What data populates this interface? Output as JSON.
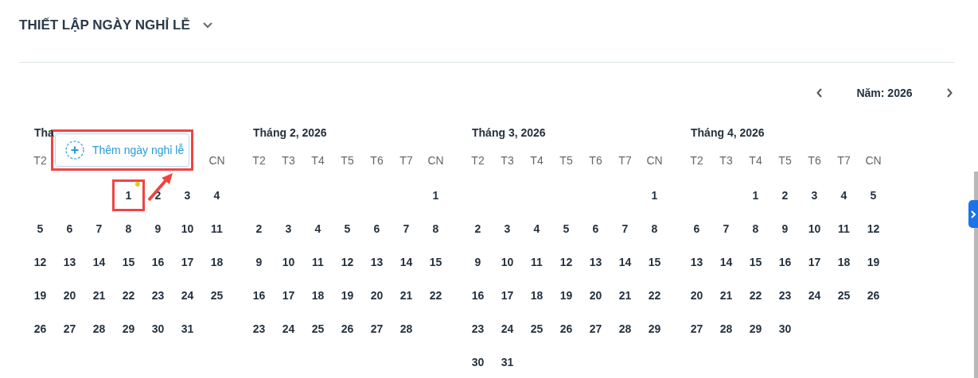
{
  "section": {
    "title": "THIẾT LẬP NGÀY NGHỈ LỄ",
    "expanded": true
  },
  "year_nav": {
    "label": "Năm: 2026"
  },
  "months": [
    {
      "title": "Tha",
      "weekdays": [
        {
          "label": "T2",
          "kind": "regular"
        },
        {
          "label": "CN",
          "kind": "last"
        }
      ],
      "weeks": [
        {
          "kind": "leading",
          "days": [
            {
              "d": "1",
              "dot": true,
              "highlighted": true
            },
            {
              "d": "2",
              "dot": false,
              "highlighted": false
            },
            {
              "d": "3",
              "dot": false,
              "highlighted": false
            },
            {
              "d": "4",
              "dot": false,
              "highlighted": false
            }
          ]
        },
        {
          "kind": "regular",
          "days": [
            {
              "d": "5",
              "dot": false,
              "highlighted": false
            },
            {
              "d": "6",
              "dot": false,
              "highlighted": false
            },
            {
              "d": "7",
              "dot": false,
              "highlighted": false
            },
            {
              "d": "8",
              "dot": false,
              "highlighted": false
            },
            {
              "d": "9",
              "dot": false,
              "highlighted": false
            },
            {
              "d": "10",
              "dot": false,
              "highlighted": false
            },
            {
              "d": "11",
              "dot": false,
              "highlighted": false
            }
          ]
        },
        {
          "kind": "regular",
          "days": [
            {
              "d": "12",
              "dot": false,
              "highlighted": false
            },
            {
              "d": "13",
              "dot": false,
              "highlighted": false
            },
            {
              "d": "14",
              "dot": false,
              "highlighted": false
            },
            {
              "d": "15",
              "dot": false,
              "highlighted": false
            },
            {
              "d": "16",
              "dot": false,
              "highlighted": false
            },
            {
              "d": "17",
              "dot": false,
              "highlighted": false
            },
            {
              "d": "18",
              "dot": false,
              "highlighted": false
            }
          ]
        },
        {
          "kind": "regular",
          "days": [
            {
              "d": "19",
              "dot": false,
              "highlighted": false
            },
            {
              "d": "20",
              "dot": false,
              "highlighted": false
            },
            {
              "d": "21",
              "dot": false,
              "highlighted": false
            },
            {
              "d": "22",
              "dot": false,
              "highlighted": false
            },
            {
              "d": "23",
              "dot": false,
              "highlighted": false
            },
            {
              "d": "24",
              "dot": false,
              "highlighted": false
            },
            {
              "d": "25",
              "dot": false,
              "highlighted": false
            }
          ]
        },
        {
          "kind": "regular",
          "days": [
            {
              "d": "26",
              "dot": false,
              "highlighted": false
            },
            {
              "d": "27",
              "dot": false,
              "highlighted": false
            },
            {
              "d": "28",
              "dot": false,
              "highlighted": false
            },
            {
              "d": "29",
              "dot": false,
              "highlighted": false
            },
            {
              "d": "30",
              "dot": false,
              "highlighted": false
            },
            {
              "d": "31",
              "dot": false,
              "highlighted": false
            }
          ]
        }
      ]
    },
    {
      "title": "Tháng 2, 2026",
      "weekdays": [
        "T2",
        "T3",
        "T4",
        "T5",
        "T6",
        "T7",
        "CN"
      ],
      "weeks": [
        {
          "kind": "leading",
          "days": [
            {
              "d": "1",
              "dot": false,
              "highlighted": false
            }
          ]
        },
        {
          "kind": "regular",
          "days": [
            {
              "d": "2",
              "dot": false,
              "highlighted": false
            },
            {
              "d": "3",
              "dot": false,
              "highlighted": false
            },
            {
              "d": "4",
              "dot": false,
              "highlighted": false
            },
            {
              "d": "5",
              "dot": false,
              "highlighted": false
            },
            {
              "d": "6",
              "dot": false,
              "highlighted": false
            },
            {
              "d": "7",
              "dot": false,
              "highlighted": false
            },
            {
              "d": "8",
              "dot": false,
              "highlighted": false
            }
          ]
        },
        {
          "kind": "regular",
          "days": [
            {
              "d": "9",
              "dot": false,
              "highlighted": false
            },
            {
              "d": "10",
              "dot": false,
              "highlighted": false
            },
            {
              "d": "11",
              "dot": false,
              "highlighted": false
            },
            {
              "d": "12",
              "dot": false,
              "highlighted": false
            },
            {
              "d": "13",
              "dot": false,
              "highlighted": false
            },
            {
              "d": "14",
              "dot": false,
              "highlighted": false
            },
            {
              "d": "15",
              "dot": false,
              "highlighted": false
            }
          ]
        },
        {
          "kind": "regular",
          "days": [
            {
              "d": "16",
              "dot": false,
              "highlighted": false
            },
            {
              "d": "17",
              "dot": false,
              "highlighted": false
            },
            {
              "d": "18",
              "dot": false,
              "highlighted": false
            },
            {
              "d": "19",
              "dot": false,
              "highlighted": false
            },
            {
              "d": "20",
              "dot": false,
              "highlighted": false
            },
            {
              "d": "21",
              "dot": false,
              "highlighted": false
            },
            {
              "d": "22",
              "dot": false,
              "highlighted": false
            }
          ]
        },
        {
          "kind": "regular",
          "days": [
            {
              "d": "23",
              "dot": false,
              "highlighted": false
            },
            {
              "d": "24",
              "dot": false,
              "highlighted": false
            },
            {
              "d": "25",
              "dot": false,
              "highlighted": false
            },
            {
              "d": "26",
              "dot": false,
              "highlighted": false
            },
            {
              "d": "27",
              "dot": false,
              "highlighted": false
            },
            {
              "d": "28",
              "dot": false,
              "highlighted": false
            }
          ]
        }
      ]
    },
    {
      "title": "Tháng 3, 2026",
      "weekdays": [
        "T2",
        "T3",
        "T4",
        "T5",
        "T6",
        "T7",
        "CN"
      ],
      "weeks": [
        {
          "kind": "leading",
          "days": [
            {
              "d": "1",
              "dot": false,
              "highlighted": false
            }
          ]
        },
        {
          "kind": "regular",
          "days": [
            {
              "d": "2",
              "dot": false,
              "highlighted": false
            },
            {
              "d": "3",
              "dot": false,
              "highlighted": false
            },
            {
              "d": "4",
              "dot": false,
              "highlighted": false
            },
            {
              "d": "5",
              "dot": false,
              "highlighted": false
            },
            {
              "d": "6",
              "dot": false,
              "highlighted": false
            },
            {
              "d": "7",
              "dot": false,
              "highlighted": false
            },
            {
              "d": "8",
              "dot": false,
              "highlighted": false
            }
          ]
        },
        {
          "kind": "regular",
          "days": [
            {
              "d": "9",
              "dot": false,
              "highlighted": false
            },
            {
              "d": "10",
              "dot": false,
              "highlighted": false
            },
            {
              "d": "11",
              "dot": false,
              "highlighted": false
            },
            {
              "d": "12",
              "dot": false,
              "highlighted": false
            },
            {
              "d": "13",
              "dot": false,
              "highlighted": false
            },
            {
              "d": "14",
              "dot": false,
              "highlighted": false
            },
            {
              "d": "15",
              "dot": false,
              "highlighted": false
            }
          ]
        },
        {
          "kind": "regular",
          "days": [
            {
              "d": "16",
              "dot": false,
              "highlighted": false
            },
            {
              "d": "17",
              "dot": false,
              "highlighted": false
            },
            {
              "d": "18",
              "dot": false,
              "highlighted": false
            },
            {
              "d": "19",
              "dot": false,
              "highlighted": false
            },
            {
              "d": "20",
              "dot": false,
              "highlighted": false
            },
            {
              "d": "21",
              "dot": false,
              "highlighted": false
            },
            {
              "d": "22",
              "dot": false,
              "highlighted": false
            }
          ]
        },
        {
          "kind": "regular",
          "days": [
            {
              "d": "23",
              "dot": false,
              "highlighted": false
            },
            {
              "d": "24",
              "dot": false,
              "highlighted": false
            },
            {
              "d": "25",
              "dot": false,
              "highlighted": false
            },
            {
              "d": "26",
              "dot": false,
              "highlighted": false
            },
            {
              "d": "27",
              "dot": false,
              "highlighted": false
            },
            {
              "d": "28",
              "dot": false,
              "highlighted": false
            },
            {
              "d": "29",
              "dot": false,
              "highlighted": false
            }
          ]
        },
        {
          "kind": "regular",
          "days": [
            {
              "d": "30",
              "dot": false,
              "highlighted": false
            },
            {
              "d": "31",
              "dot": false,
              "highlighted": false
            }
          ]
        }
      ]
    },
    {
      "title": "Tháng 4, 2026",
      "weekdays": [
        "T2",
        "T3",
        "T4",
        "T5",
        "T6",
        "T7",
        "CN"
      ],
      "weeks": [
        {
          "kind": "leading",
          "days": [
            {
              "d": "1",
              "dot": false,
              "highlighted": false
            },
            {
              "d": "2",
              "dot": false,
              "highlighted": false
            },
            {
              "d": "3",
              "dot": false,
              "highlighted": false
            },
            {
              "d": "4",
              "dot": false,
              "highlighted": false
            },
            {
              "d": "5",
              "dot": false,
              "highlighted": false
            }
          ]
        },
        {
          "kind": "regular",
          "days": [
            {
              "d": "6",
              "dot": false,
              "highlighted": false
            },
            {
              "d": "7",
              "dot": false,
              "highlighted": false
            },
            {
              "d": "8",
              "dot": false,
              "highlighted": false
            },
            {
              "d": "9",
              "dot": false,
              "highlighted": false
            },
            {
              "d": "10",
              "dot": false,
              "highlighted": false
            },
            {
              "d": "11",
              "dot": false,
              "highlighted": false
            },
            {
              "d": "12",
              "dot": false,
              "highlighted": false
            }
          ]
        },
        {
          "kind": "regular",
          "days": [
            {
              "d": "13",
              "dot": false,
              "highlighted": false
            },
            {
              "d": "14",
              "dot": false,
              "highlighted": false
            },
            {
              "d": "15",
              "dot": false,
              "highlighted": false
            },
            {
              "d": "16",
              "dot": false,
              "highlighted": false
            },
            {
              "d": "17",
              "dot": false,
              "highlighted": false
            },
            {
              "d": "18",
              "dot": false,
              "highlighted": false
            },
            {
              "d": "19",
              "dot": false,
              "highlighted": false
            }
          ]
        },
        {
          "kind": "regular",
          "days": [
            {
              "d": "20",
              "dot": false,
              "highlighted": false
            },
            {
              "d": "21",
              "dot": false,
              "highlighted": false
            },
            {
              "d": "22",
              "dot": false,
              "highlighted": false
            },
            {
              "d": "23",
              "dot": false,
              "highlighted": false
            },
            {
              "d": "24",
              "dot": false,
              "highlighted": false
            },
            {
              "d": "25",
              "dot": false,
              "highlighted": false
            },
            {
              "d": "26",
              "dot": false,
              "highlighted": false
            }
          ]
        },
        {
          "kind": "regular",
          "days": [
            {
              "d": "27",
              "dot": false,
              "highlighted": false
            },
            {
              "d": "28",
              "dot": false,
              "highlighted": false
            },
            {
              "d": "29",
              "dot": false,
              "highlighted": false
            },
            {
              "d": "30",
              "dot": false,
              "highlighted": false
            }
          ]
        }
      ]
    }
  ],
  "popup": {
    "label": "Thêm ngày nghỉ lễ",
    "highlighted": true
  }
}
